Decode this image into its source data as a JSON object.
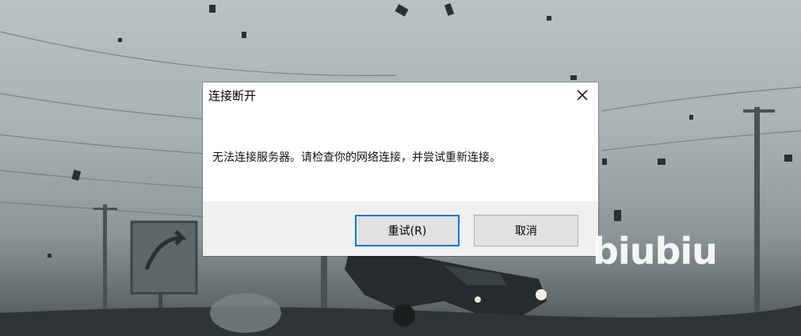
{
  "dialog": {
    "title": "连接断开",
    "close_icon": "close-icon",
    "message": "无法连接服务器。请检查你的网络连接，并尝试重新连接。",
    "buttons": {
      "retry_label": "重试(R)",
      "cancel_label": "取消"
    }
  },
  "watermark": {
    "text": "biubiu"
  },
  "colors": {
    "default_button_border": "#0078d7",
    "footer_bg": "#f0f0f0",
    "dialog_bg": "#ffffff"
  }
}
